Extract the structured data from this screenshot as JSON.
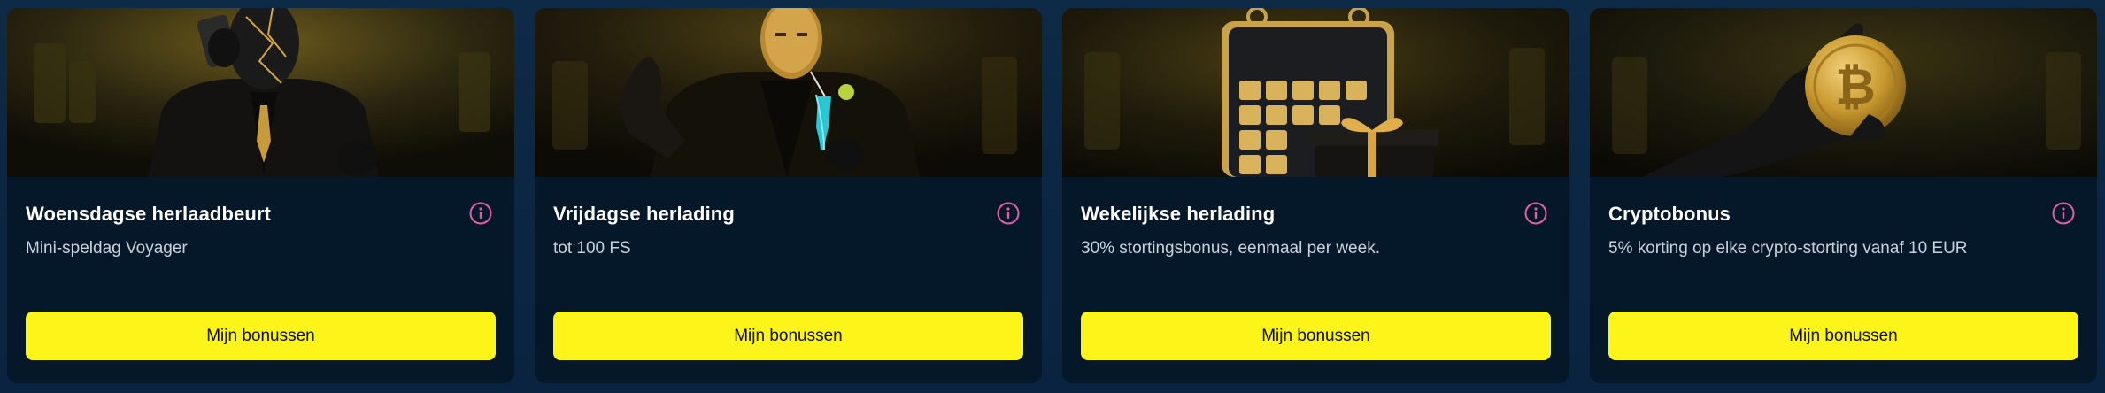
{
  "colors": {
    "card_bg": "#04182a",
    "page_bg": "#0b2742",
    "button_bg": "#fdf51a",
    "info_icon": "#e05fa8",
    "gold": "#c79a3a"
  },
  "cards": [
    {
      "title": "Woensdagse herlaadbeurt",
      "subtitle": "Mini-speldag Voyager",
      "button_label": "Mijn bonussen",
      "icon": "info-icon",
      "image": "masked-man-on-phone-image"
    },
    {
      "title": "Vrijdagse herlading",
      "subtitle": "tot 100 FS",
      "button_label": "Mijn bonussen",
      "icon": "info-icon",
      "image": "masked-man-with-cocktail-image"
    },
    {
      "title": "Wekelijkse herlading",
      "subtitle": "30% stortingsbonus, eenmaal per week.",
      "button_label": "Mijn bonussen",
      "icon": "info-icon",
      "image": "calendar-and-gift-image"
    },
    {
      "title": "Cryptobonus",
      "subtitle": "5% korting op elke crypto-storting vanaf 10 EUR",
      "button_label": "Mijn bonussen",
      "icon": "info-icon",
      "image": "gloved-hand-bitcoin-image"
    }
  ]
}
